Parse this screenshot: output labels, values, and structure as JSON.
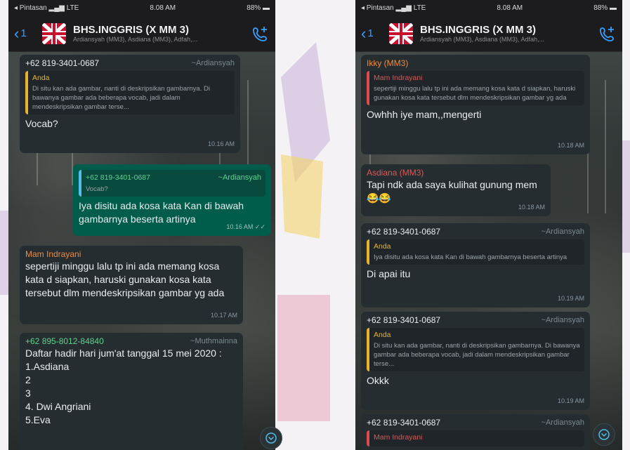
{
  "screens": [
    {
      "status": {
        "carrier": "◂ Pintasan",
        "network": "LTE",
        "time": "8.08 AM",
        "battery": "88%"
      },
      "header": {
        "back_count": "1",
        "title": "BHS.INGGRIS (X MM 3)",
        "subtitle": "Ardiansyah (MM3), Asdiana (MM3), Adfah,..."
      },
      "messages": [
        {
          "sender": "+62 819-3401-0687",
          "sender_tag": "~Ardiansyah",
          "text": "",
          "time": ""
        },
        {
          "quote_name": "Anda",
          "quote_text": "Di situ kan ada gambar, nanti di deskripsikan gambarnya. Di bawanya gambar ada beberapa vocab, jadi dalam mendeskripsikan gambar terse...",
          "text": "Vocab?",
          "time": "10.16 AM"
        },
        {
          "quote_name": "+62 819-3401-0687",
          "quote_tag": "~Ardiansyah",
          "quote_text": "Vocab?",
          "text": "Iya disitu ada kosa kata Kan di bawah gambarnya beserta artinya",
          "time": "10.16 AM ✓✓"
        },
        {
          "sender": "Mam Indrayani",
          "text": "sepertiji minggu lalu tp ini ada memang kosa kata d siapkan, haruski gunakan kosa kata tersebut dlm mendeskripsikan gambar yg ada",
          "time": "10.17 AM"
        },
        {
          "sender": "+62 895-8012-84840",
          "sender_tag": "~Muthmainna",
          "text": "Daftar hadir hari jum'at tanggal 15 mei 2020 :",
          "list": [
            "1.Asdiana",
            "2",
            "3",
            "4. Dwi Angriani",
            "5.Eva"
          ]
        }
      ]
    },
    {
      "status": {
        "carrier": "◂ Pintasan",
        "network": "LTE",
        "time": "8.08 AM",
        "battery": "88%"
      },
      "header": {
        "back_count": "1",
        "title": "BHS.INGGRIS (X MM 3)",
        "subtitle": "Ardiansyah (MM3), Asdiana (MM3), Adfah,..."
      },
      "messages": [
        {
          "sender": "Ikky (MM3)",
          "quote_name": "Mam Indrayani",
          "quote_text": "sepertiji minggu lalu tp ini ada memang kosa kata d siapkan, haruski gunakan kosa kata tersebut dlm mendeskripsikan gambar yg ada",
          "text": "Owhhh iye mam,,mengerti",
          "time": "10.18 AM"
        },
        {
          "sender": "Asdiana (MM3)",
          "text": "Tapi ndk ada saya kulihat gunung mem😂😂",
          "time": "10.18 AM"
        },
        {
          "sender": "+62 819-3401-0687",
          "sender_tag": "~Ardiansyah",
          "quote_name": "Anda",
          "quote_text": "Iya disitu ada kosa kata Kan di bawah gambarnya beserta artinya",
          "text": "Di apai itu",
          "time": "10.19 AM"
        },
        {
          "sender": "+62 819-3401-0687",
          "sender_tag": "~Ardiansyah",
          "quote_name": "Anda",
          "quote_text": "Di situ kan ada gambar, nanti di deskripsikan gambarnya. Di bawanya gambar ada beberapa vocab, jadi dalam mendeskripsikan gambar terse...",
          "text": "Okkk",
          "time": "10.19 AM"
        },
        {
          "sender": "+62 819-3401-0687",
          "sender_tag": "~Ardiansyah",
          "quote_name": "Mam Indrayani"
        }
      ]
    }
  ],
  "colors": {
    "accent": "#3aa0ff",
    "sender_green": "#5fd38d",
    "sender_orange": "#f08a3c",
    "sender_red": "#e05555",
    "outgoing_bubble": "#005c4b",
    "incoming_bubble": "#262d31"
  },
  "icons": [
    "back-chevron-icon",
    "group-avatar-flag-icon",
    "add-call-icon",
    "scroll-down-icon",
    "signal-icon",
    "battery-icon"
  ]
}
